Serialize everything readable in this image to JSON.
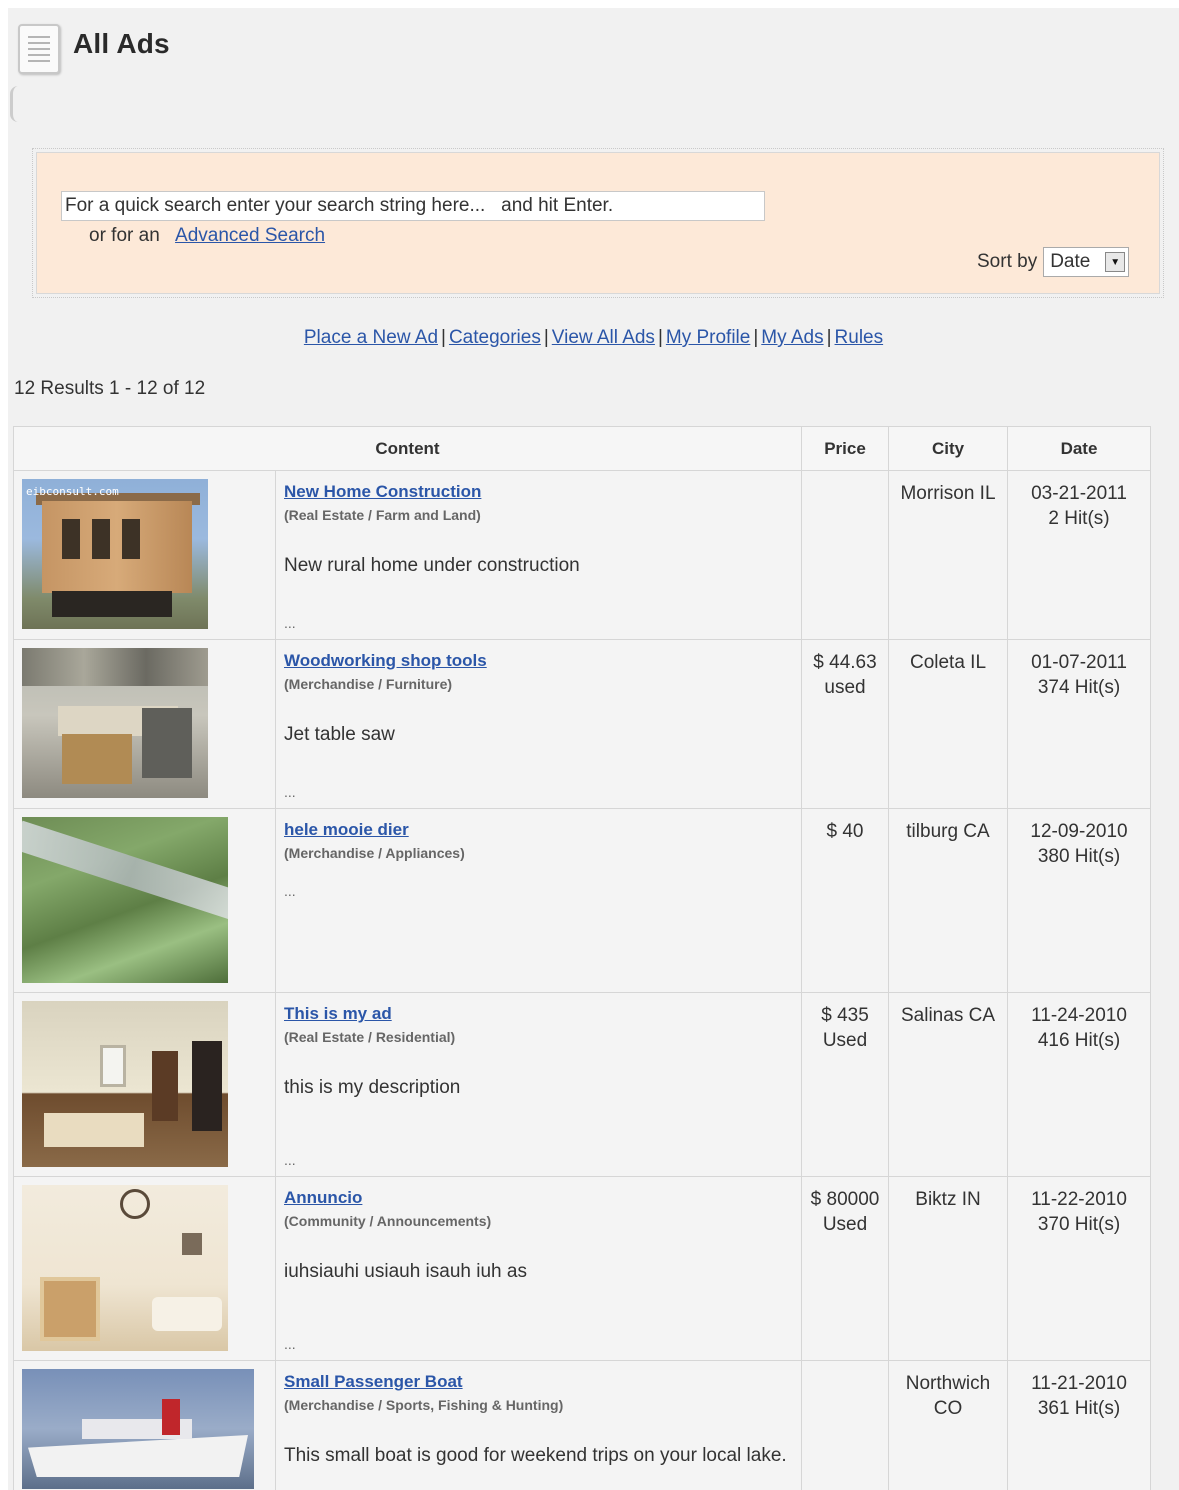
{
  "page": {
    "title": "All Ads"
  },
  "search": {
    "placeholder": "For a quick search enter your search string here...   and hit Enter.",
    "or_text": "or for an",
    "advanced_label": "Advanced Search",
    "sort_label": "Sort by",
    "sort_value": "Date"
  },
  "nav": {
    "links": [
      "Place a New Ad",
      "Categories",
      "View All Ads",
      "My Profile",
      "My Ads",
      "Rules"
    ],
    "separator": "|"
  },
  "results": {
    "summary": "12 Results 1 - 12 of 12"
  },
  "table": {
    "headers": [
      "Content",
      "Price",
      "City",
      "Date"
    ],
    "rows": [
      {
        "title": "New Home Construction",
        "category": "(Real Estate / Farm and Land)",
        "description": "New rural home under construction",
        "more": "...",
        "price_line1": "",
        "price_line2": "",
        "city_line1": "Morrison IL",
        "city_line2": "",
        "date": "03-21-2011",
        "hits": "2 Hit(s)",
        "image_watermark": "eibconsult.com"
      },
      {
        "title": "Woodworking shop tools",
        "category": "(Merchandise / Furniture)",
        "description": "Jet table saw",
        "more": "...",
        "price_line1": "$ 44.63",
        "price_line2": "used",
        "city_line1": "Coleta IL",
        "city_line2": "",
        "date": "01-07-2011",
        "hits": "374 Hit(s)"
      },
      {
        "title": "hele mooie dier",
        "category": "(Merchandise / Appliances)",
        "description": "",
        "more": "...",
        "price_line1": "$ 40",
        "price_line2": "",
        "city_line1": "tilburg CA",
        "city_line2": "",
        "date": "12-09-2010",
        "hits": "380 Hit(s)"
      },
      {
        "title": "This is my ad",
        "category": "(Real Estate / Residential)",
        "description": "this is my description",
        "more": "...",
        "price_line1": "$ 435",
        "price_line2": "Used",
        "city_line1": "Salinas CA",
        "city_line2": "",
        "date": "11-24-2010",
        "hits": "416 Hit(s)"
      },
      {
        "title": "Annuncio",
        "category": "(Community / Announcements)",
        "description": "iuhsiauhi usiauh isauh iuh as",
        "more": "...",
        "price_line1": "$ 80000",
        "price_line2": "Used",
        "city_line1": "Biktz IN",
        "city_line2": "",
        "date": "11-22-2010",
        "hits": "370 Hit(s)"
      },
      {
        "title": "Small Passenger Boat",
        "category": "(Merchandise / Sports, Fishing & Hunting)",
        "description": "This small boat is good for weekend trips on your local lake.",
        "more": "",
        "price_line1": "",
        "price_line2": "",
        "city_line1": "Northwich",
        "city_line2": "CO",
        "date": "11-21-2010",
        "hits": "361 Hit(s)"
      }
    ]
  },
  "icons": {
    "title_icon": "document-list-icon",
    "sort_dropdown": "chevron-down-icon"
  }
}
